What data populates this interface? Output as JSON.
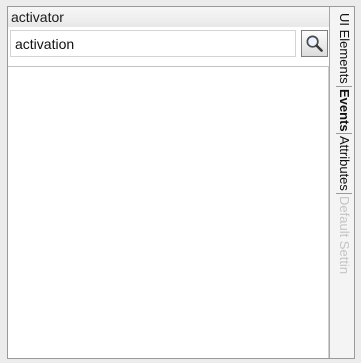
{
  "panel": {
    "title": "activator"
  },
  "search": {
    "value": "activation",
    "button_icon": "magnifier-icon"
  },
  "tabs": [
    {
      "label": "UI Elements"
    },
    {
      "label": "Events"
    },
    {
      "label": "Attributes"
    },
    {
      "label": "Default Settin"
    }
  ],
  "colors": {
    "frame_border": "#9a9a9a",
    "tab_text": "#111111",
    "tab_dim_text": "#c4c4c4"
  }
}
